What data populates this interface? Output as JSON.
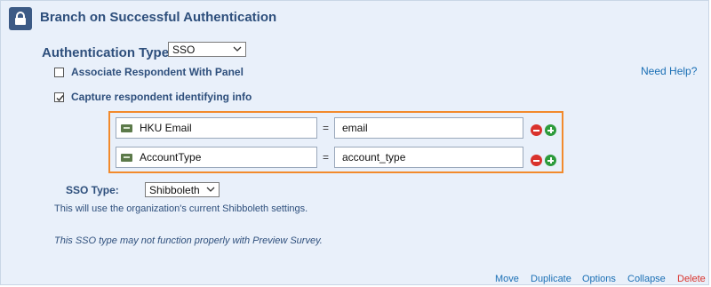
{
  "header": {
    "title": "Branch on Successful Authentication",
    "icon": "lock-icon"
  },
  "auth": {
    "label": "Authentication Type:",
    "selected": "SSO"
  },
  "options": {
    "associate_label": "Associate Respondent With Panel",
    "associate_checked": false,
    "capture_label": "Capture respondent identifying info",
    "capture_checked": true
  },
  "help_link": "Need Help?",
  "mappings": [
    {
      "field": "HKU Email",
      "equals": "=",
      "value": "email"
    },
    {
      "field": "AccountType",
      "equals": "=",
      "value": "account_type"
    }
  ],
  "sso": {
    "label": "SSO Type:",
    "selected": "Shibboleth",
    "info": "This will use the organization's current Shibboleth settings.",
    "warning": "This SSO type may not function properly with Preview Survey."
  },
  "footer": {
    "move": "Move",
    "duplicate": "Duplicate",
    "options": "Options",
    "collapse": "Collapse",
    "delete": "Delete"
  },
  "colors": {
    "accent": "#f28a2c",
    "link": "#1a6fb5",
    "delete": "#d9322c",
    "add": "#2d9b3b"
  }
}
